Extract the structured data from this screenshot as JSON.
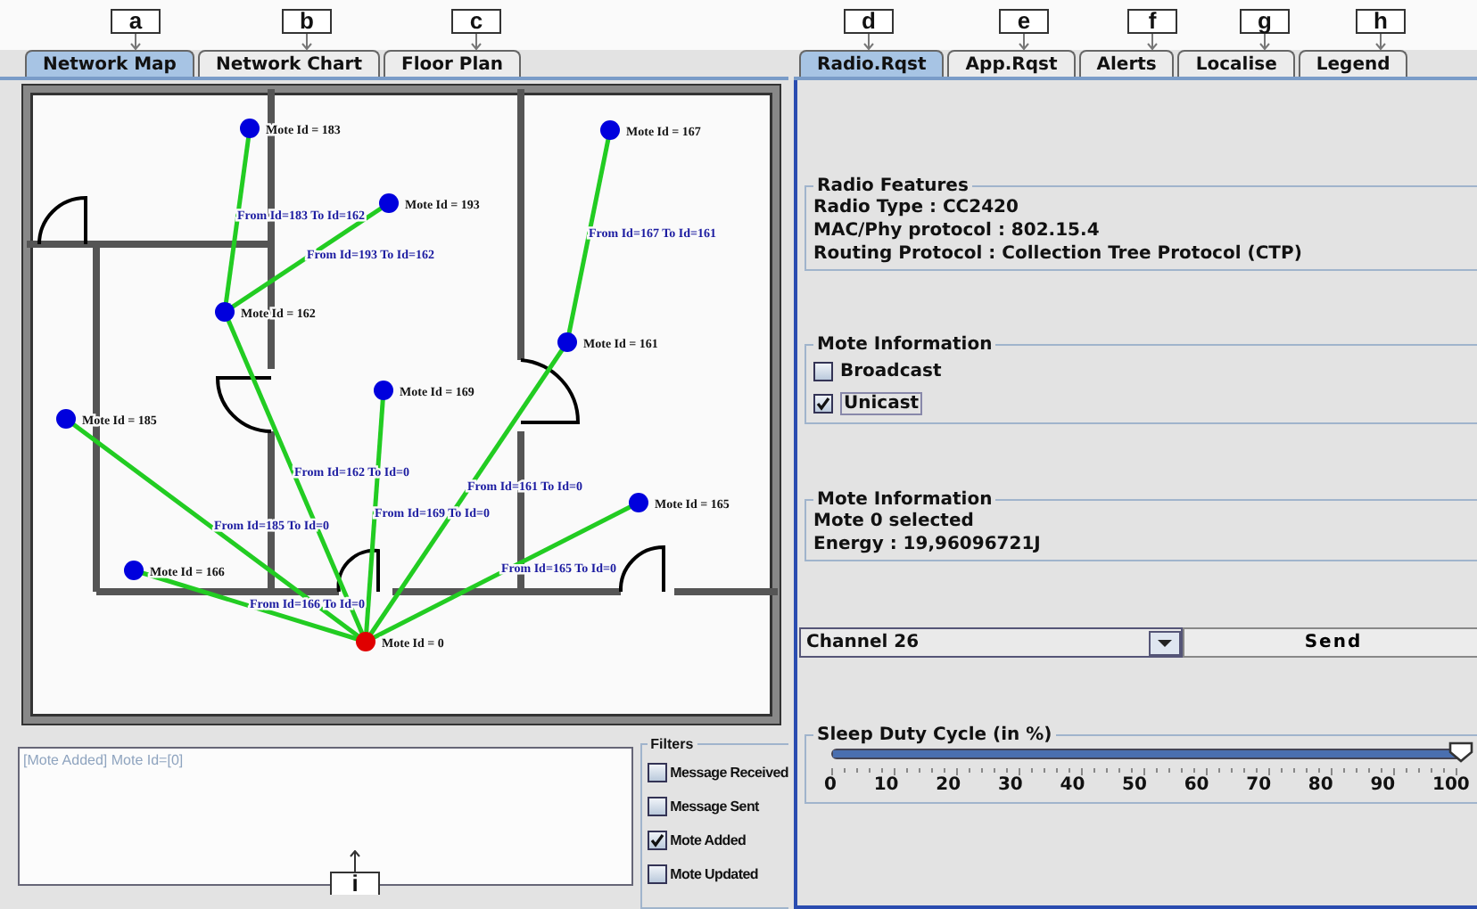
{
  "callouts_top": [
    "a",
    "b",
    "c",
    "d",
    "e",
    "f",
    "g",
    "h"
  ],
  "left_tabs": [
    {
      "label": "Network Map",
      "selected": true
    },
    {
      "label": "Network Chart",
      "selected": false
    },
    {
      "label": "Floor Plan",
      "selected": false
    }
  ],
  "map": {
    "motes": [
      {
        "label": "Mote Id = 183",
        "kind": "node"
      },
      {
        "label": "Mote Id = 193",
        "kind": "node"
      },
      {
        "label": "Mote Id = 162",
        "kind": "node"
      },
      {
        "label": "Mote Id = 167",
        "kind": "node"
      },
      {
        "label": "Mote Id = 161",
        "kind": "node"
      },
      {
        "label": "Mote Id = 169",
        "kind": "node"
      },
      {
        "label": "Mote Id = 185",
        "kind": "node"
      },
      {
        "label": "Mote Id = 165",
        "kind": "node"
      },
      {
        "label": "Mote Id = 166",
        "kind": "node"
      },
      {
        "label": "Mote Id = 0",
        "kind": "sink"
      }
    ],
    "links": [
      {
        "label": "From Id=183 To Id=162"
      },
      {
        "label": "From Id=193 To Id=162"
      },
      {
        "label": "From Id=162 To Id=0"
      },
      {
        "label": "From Id=167 To Id=161"
      },
      {
        "label": "From Id=161 To Id=0"
      },
      {
        "label": "From Id=169 To Id=0"
      },
      {
        "label": "From Id=185 To Id=0"
      },
      {
        "label": "From Id=165 To Id=0"
      },
      {
        "label": "From Id=166 To Id=0"
      }
    ]
  },
  "log": {
    "lines": [
      "[Mote Added] Mote Id=[0]"
    ]
  },
  "filters": {
    "title": "Filters",
    "items": [
      {
        "label": "Message Received",
        "checked": false
      },
      {
        "label": "Message Sent",
        "checked": false
      },
      {
        "label": "Mote Added",
        "checked": true
      },
      {
        "label": "Mote Updated",
        "checked": false
      }
    ]
  },
  "callout_bottom": "i",
  "right_tabs": [
    {
      "label": "Radio.Rqst",
      "selected": true
    },
    {
      "label": "App.Rqst",
      "selected": false
    },
    {
      "label": "Alerts",
      "selected": false
    },
    {
      "label": "Localise",
      "selected": false
    },
    {
      "label": "Legend",
      "selected": false
    }
  ],
  "radio_features": {
    "title": "Radio Features",
    "lines": [
      "Radio Type : CC2420",
      "MAC/Phy protocol : 802.15.4",
      "Routing Protocol : Collection Tree Protocol (CTP)"
    ]
  },
  "mote_mode": {
    "title": "Mote Information",
    "items": [
      {
        "label": "Broadcast",
        "checked": false
      },
      {
        "label": "Unicast",
        "checked": true
      }
    ]
  },
  "mote_information": {
    "title": "Mote Information",
    "lines": [
      "Mote 0 selected",
      "Energy : 19,96096721J"
    ]
  },
  "channel": {
    "value": "Channel 26"
  },
  "send_button": "Send",
  "sleep": {
    "title": "Sleep Duty Cycle (in %)",
    "level": 1,
    "ticks": [
      "0",
      "10",
      "20",
      "30",
      "40",
      "50",
      "60",
      "70",
      "80",
      "90",
      "100"
    ]
  }
}
